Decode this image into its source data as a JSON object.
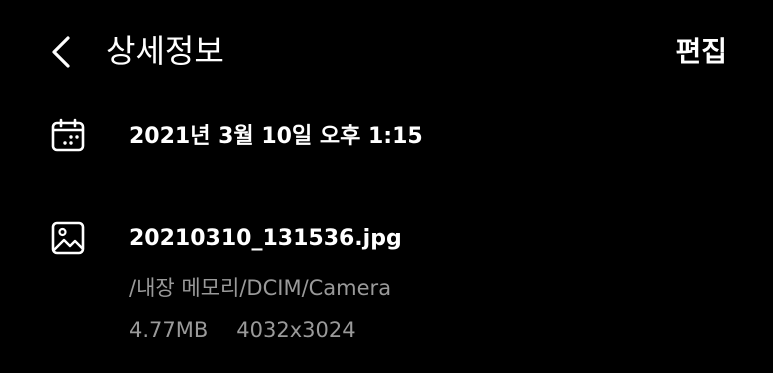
{
  "header": {
    "back_icon": "chevron-left-icon",
    "title": "상세정보",
    "edit_label": "편집"
  },
  "date_row": {
    "icon": "calendar-icon",
    "datetime": "2021년 3월 10일 오후 1:15"
  },
  "file_row": {
    "icon": "image-icon",
    "filename": "20210310_131536.jpg",
    "path": "/내장 메모리/DCIM/Camera",
    "size": "4.77MB",
    "resolution": "4032x3024"
  },
  "colors": {
    "background": "#000000",
    "primary_text": "#ffffff",
    "secondary_text": "#9a9a9a"
  }
}
